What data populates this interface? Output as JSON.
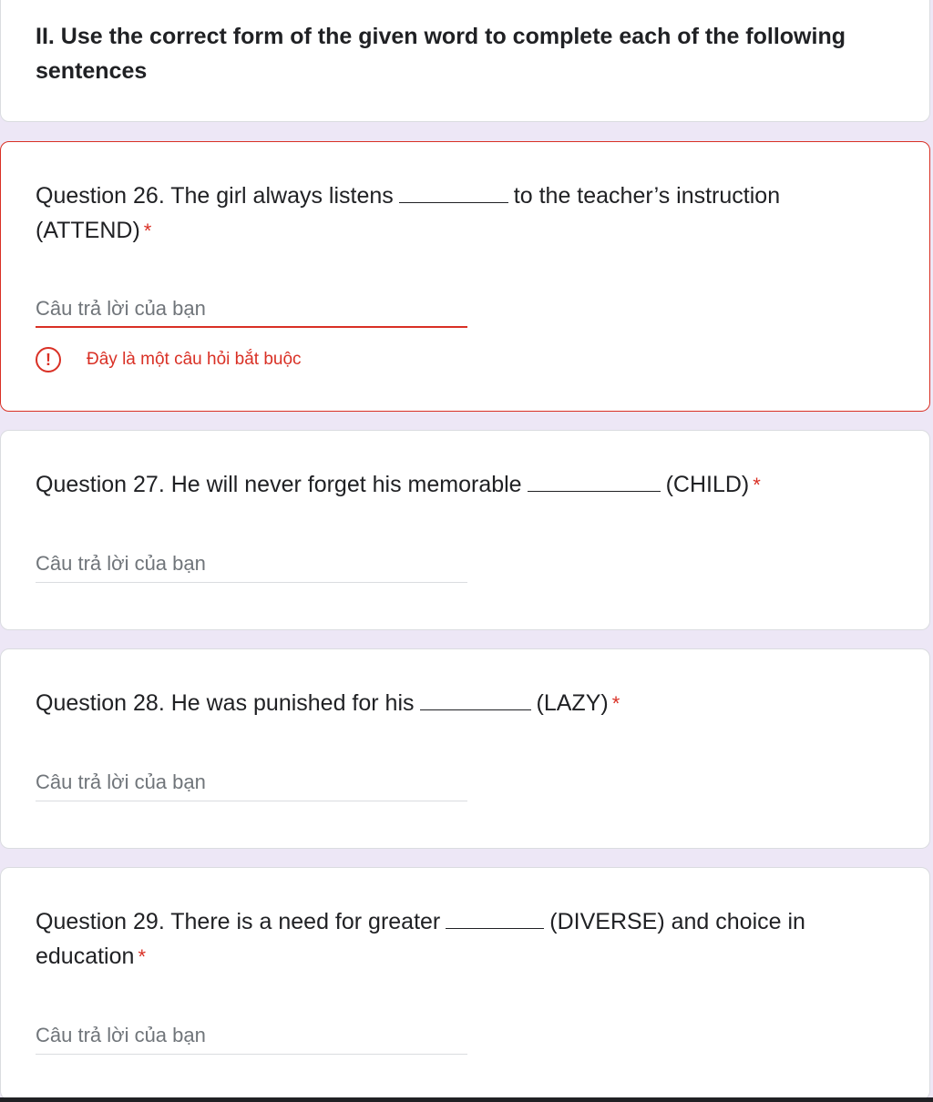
{
  "section": {
    "title": "II. Use the correct form of the given word to complete each of the following sentences"
  },
  "questions": [
    {
      "before": "Question 26. The girl always listens",
      "after": "to the teacher’s instruction (ATTEND)",
      "required_mark": "*",
      "answer_placeholder": "Câu trả lời của bạn",
      "answer_value": "",
      "error": "Đây là một câu hỏi bắt buộc",
      "error_icon": "!"
    },
    {
      "before": "Question 27. He will never forget his memorable",
      "after": "(CHILD)",
      "required_mark": "*",
      "answer_placeholder": "Câu trả lời của bạn",
      "answer_value": ""
    },
    {
      "before": "Question 28. He was punished for his",
      "after": "(LAZY)",
      "required_mark": "*",
      "answer_placeholder": "Câu trả lời của bạn",
      "answer_value": ""
    },
    {
      "before": "Question 29. There is a need for greater",
      "after": "(DIVERSE) and choice in education",
      "required_mark": "*",
      "answer_placeholder": "Câu trả lời của bạn",
      "answer_value": ""
    }
  ],
  "colors": {
    "background": "#ede7f6",
    "error": "#d93025",
    "text": "#202124",
    "placeholder": "#70757a"
  },
  "icons": {
    "error": "exclamation-circle-icon"
  }
}
